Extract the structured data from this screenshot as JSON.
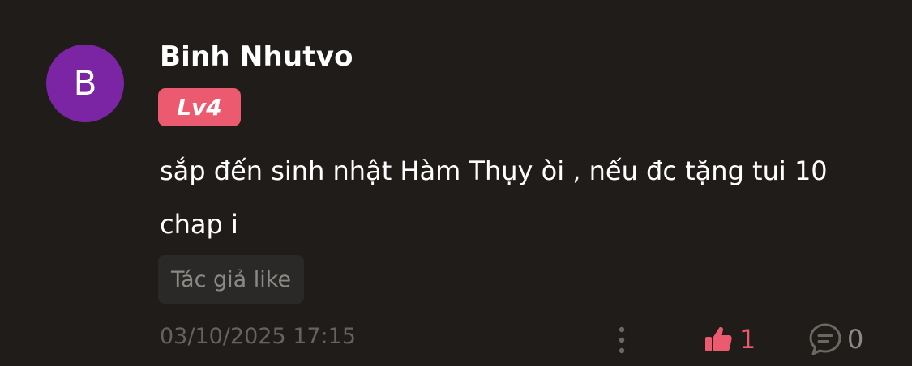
{
  "comment": {
    "avatar_letter": "B",
    "avatar_color": "#7b25a4",
    "username": "Binh Nhutvo",
    "level": "Lv4",
    "level_color": "#eb5a6e",
    "text": "sắp đến sinh nhật Hàm Thụy òi , nếu đc tặng tui 10 chap i",
    "author_like_label": "Tác giả like",
    "timestamp": "03/10/2025 17:15",
    "like_count": "1",
    "reply_count": "0",
    "icons": {
      "more": "more-vertical-icon",
      "like": "thumbs-up-icon",
      "reply": "comment-bubble-icon"
    }
  }
}
